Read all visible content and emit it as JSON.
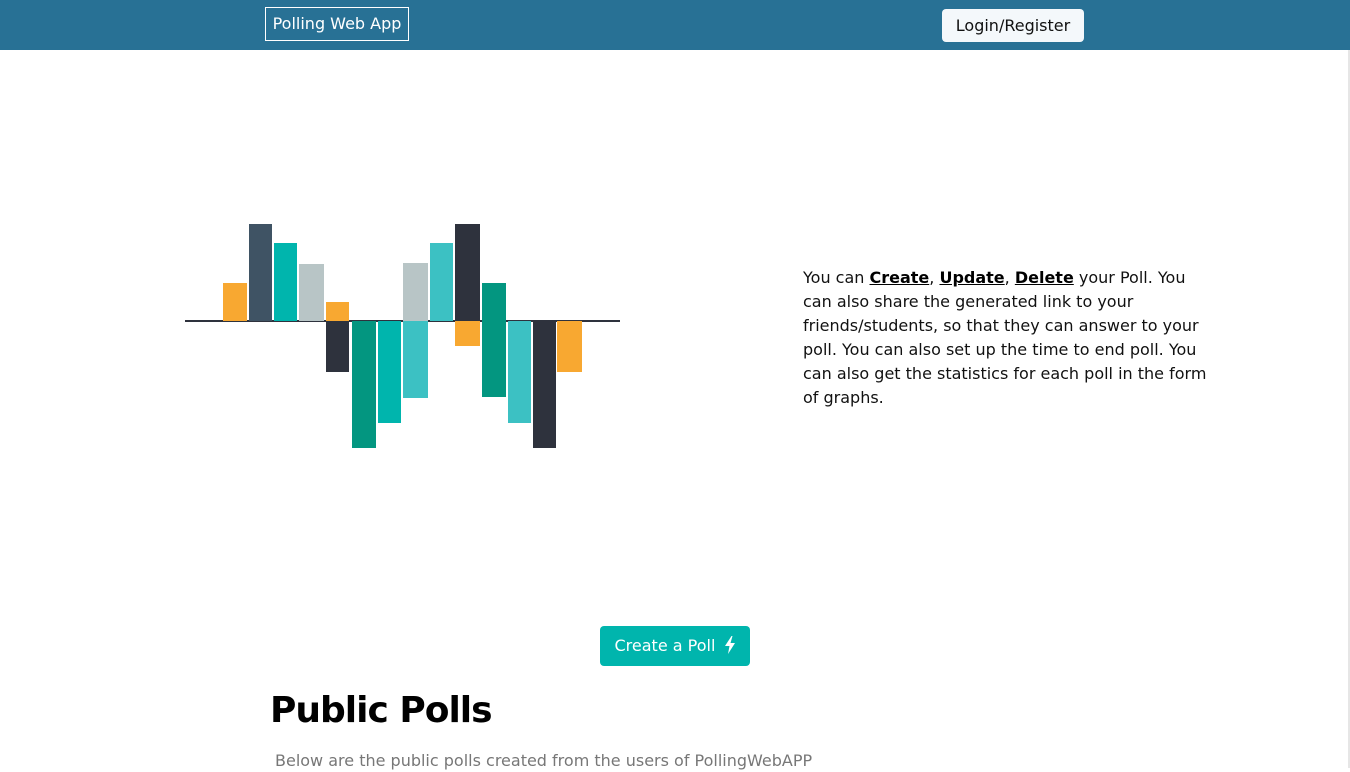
{
  "navbar": {
    "brand": "Polling Web App",
    "login_label": "Login/Register",
    "background": "#287195"
  },
  "hero": {
    "intro_1": "You can ",
    "create_word": "Create",
    "sep_1": ", ",
    "update_word": "Update",
    "sep_2": ", ",
    "delete_word": "Delete",
    "intro_2": " your Poll. You can also share the generated link to your friends/students, so that they can answer to your poll. You can also set up the time to end poll. You can also get the statistics for each poll in the form of graphs.",
    "illustration": {
      "name": "bar-chart-illustration",
      "colors": [
        "#f8a831",
        "#3f5364",
        "#00b5ad",
        "#b8c5c6",
        "#2e323d",
        "#039680",
        "#3cc1c3"
      ]
    }
  },
  "actions": {
    "create_poll_label": "Create a Poll",
    "create_poll_icon": "bolt-icon",
    "accent": "#00b5ad"
  },
  "public_polls": {
    "title": "Public Polls",
    "subtitle": "Below are the public polls created from the users of PollingWebAPP"
  }
}
